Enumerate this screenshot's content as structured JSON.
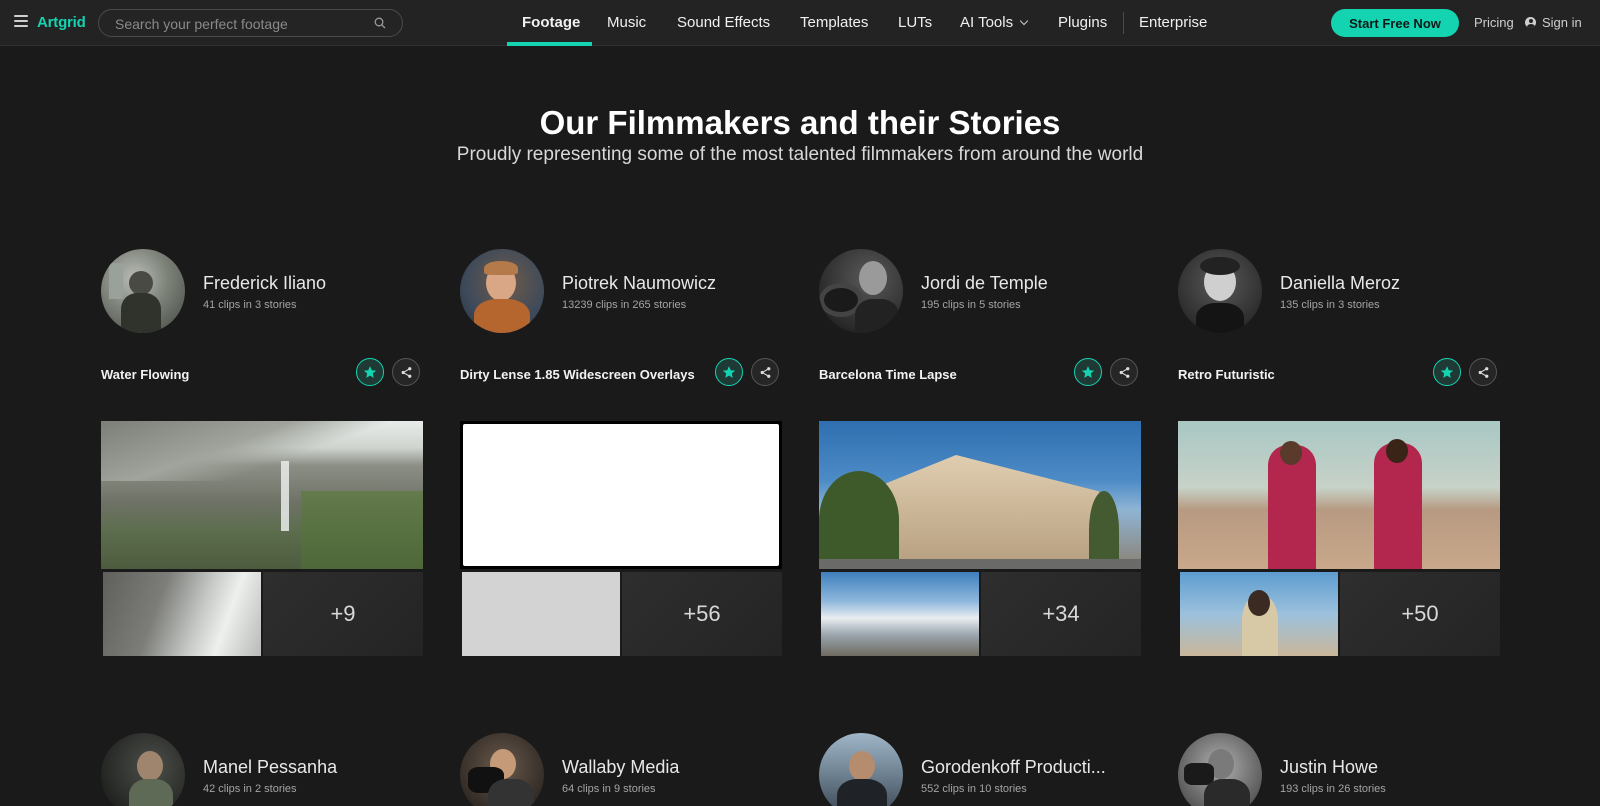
{
  "nav": {
    "logo": "Artgrid",
    "search_placeholder": "Search your perfect footage",
    "links": [
      "Footage",
      "Music",
      "Sound Effects",
      "Templates",
      "LUTs",
      "AI Tools",
      "Plugins",
      "Enterprise"
    ],
    "active_link": "Footage",
    "cta": "Start Free Now",
    "pricing": "Pricing",
    "signin": "Sign in",
    "accent_color": "#14d3b1"
  },
  "hero": {
    "title": "Our Filmmakers and their Stories",
    "subtitle": "Proudly representing some of the most talented filmmakers from around the world"
  },
  "filmmakers": [
    {
      "name": "Frederick Iliano",
      "meta": "41 clips in 3 stories",
      "story": "Water Flowing",
      "more": "+9"
    },
    {
      "name": "Piotrek Naumowicz",
      "meta": "13239 clips in 265 stories",
      "story": "Dirty Lense 1.85 Widescreen Overlays",
      "more": "+56"
    },
    {
      "name": "Jordi de Temple",
      "meta": "195 clips in 5 stories",
      "story": "Barcelona Time Lapse",
      "more": "+34"
    },
    {
      "name": "Daniella Meroz",
      "meta": "135 clips in 3 stories",
      "story": "Retro Futuristic",
      "more": "+50"
    }
  ],
  "filmmakers_row2": [
    {
      "name": "Manel Pessanha",
      "meta": "42 clips in 2 stories"
    },
    {
      "name": "Wallaby Media",
      "meta": "64 clips in 9 stories"
    },
    {
      "name": "Gorodenkoff Producti...",
      "meta": "552 clips in 10 stories"
    },
    {
      "name": "Justin Howe",
      "meta": "193 clips in 26 stories"
    }
  ]
}
